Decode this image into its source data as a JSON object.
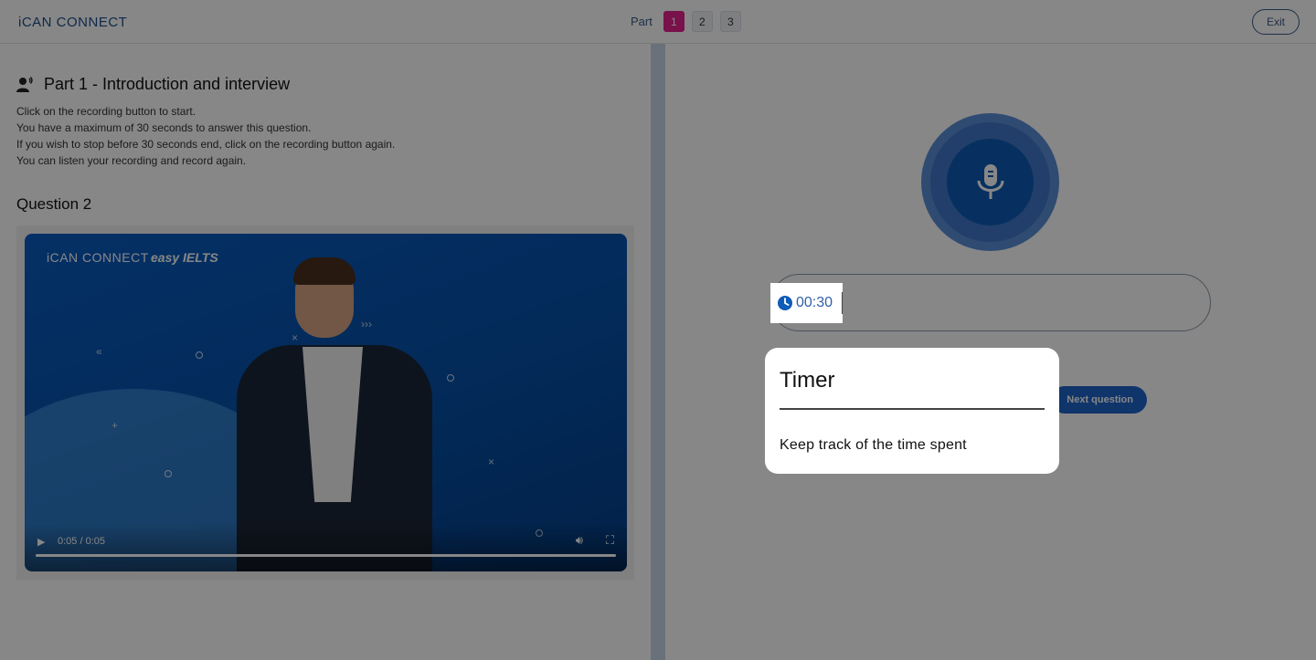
{
  "header": {
    "logo": "iCAN CONNECT",
    "part_label": "Part",
    "parts": [
      "1",
      "2",
      "3"
    ],
    "active_part": "1",
    "exit_label": "Exit"
  },
  "left": {
    "part_title": "Part 1 - Introduction and interview",
    "instructions": [
      "Click on the recording button to start.",
      "You have a maximum of 30 seconds to answer this question.",
      "If you wish to stop before 30 seconds end, click on the recording button again.",
      "You can listen your recording and record again."
    ],
    "question_title": "Question 2",
    "video": {
      "logo_left": "iCAN CONNECT",
      "logo_right": "easy IELTS",
      "time": "0:05 / 0:05",
      "progress": 1.0
    }
  },
  "right": {
    "timer_value": "00:30",
    "next_label": "Next question"
  },
  "tooltip": {
    "title": "Timer",
    "body": "Keep track of the time spent"
  },
  "colors": {
    "accent_pink": "#e5208f",
    "primary_blue": "#1e64c8",
    "mic_blue": "#0f5bb8"
  }
}
